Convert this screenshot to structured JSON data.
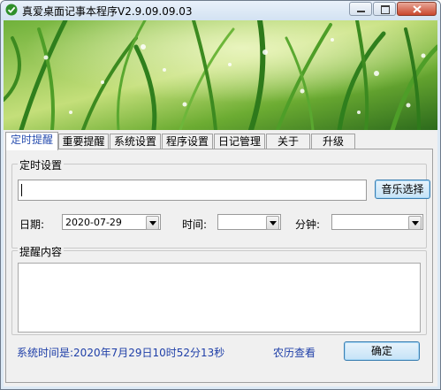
{
  "window": {
    "title": "真爱桌面记事本程序V2.9.09.09.03",
    "controls": [
      "minimize-icon",
      "maximize-icon",
      "close-icon"
    ]
  },
  "tabs": [
    {
      "label": "定时提醒",
      "active": true
    },
    {
      "label": "重要提醒",
      "active": false
    },
    {
      "label": "系统设置",
      "active": false
    },
    {
      "label": "程序设置",
      "active": false
    },
    {
      "label": "日记管理",
      "active": false
    },
    {
      "label": "关于",
      "active": false
    },
    {
      "label": "升级",
      "active": false
    }
  ],
  "timer_settings": {
    "group_title": "定时设置",
    "music_input_value": "",
    "music_button": "音乐选择",
    "date_label": "日期:",
    "date_value": "2020-07-29",
    "time_label": "时间:",
    "time_value": "",
    "minute_label": "分钟:",
    "minute_value": ""
  },
  "reminder": {
    "group_title": "提醒内容",
    "content_value": ""
  },
  "footer": {
    "system_time": "系统时间是:2020年7月29日10时52分13秒",
    "lunar_link": "农历查看",
    "ok_button": "确定"
  },
  "colors": {
    "tab_active_text": "#2a4fb0",
    "status_text": "#1f3fa8",
    "window_frame": "#dce9f5",
    "banner_grass": "#4fa32d"
  }
}
